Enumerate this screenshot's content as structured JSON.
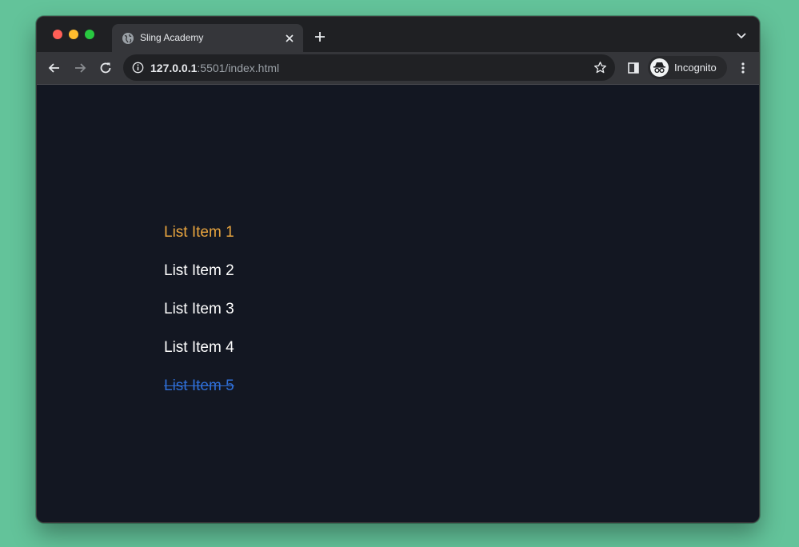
{
  "tab": {
    "title": "Sling Academy"
  },
  "address_bar": {
    "host": "127.0.0.1",
    "rest": ":5501/index.html"
  },
  "profile": {
    "label": "Incognito"
  },
  "list": {
    "items": [
      {
        "label": "List Item 1",
        "state": "highlighted"
      },
      {
        "label": "List Item 2",
        "state": "normal"
      },
      {
        "label": "List Item 3",
        "state": "normal"
      },
      {
        "label": "List Item 4",
        "state": "normal"
      },
      {
        "label": "List Item 5",
        "state": "struck-through"
      }
    ]
  },
  "colors": {
    "background": "#63c39a",
    "page": "#131722",
    "highlight": "#e9a53f",
    "struck": "#2f6fd8",
    "text": "#ffffff"
  },
  "icons": [
    "globe-icon",
    "close-icon",
    "plus-icon",
    "chevron-down-icon",
    "back-arrow-icon",
    "forward-arrow-icon",
    "reload-icon",
    "info-icon",
    "star-icon",
    "side-panel-icon",
    "incognito-icon",
    "kebab-menu-icon"
  ]
}
